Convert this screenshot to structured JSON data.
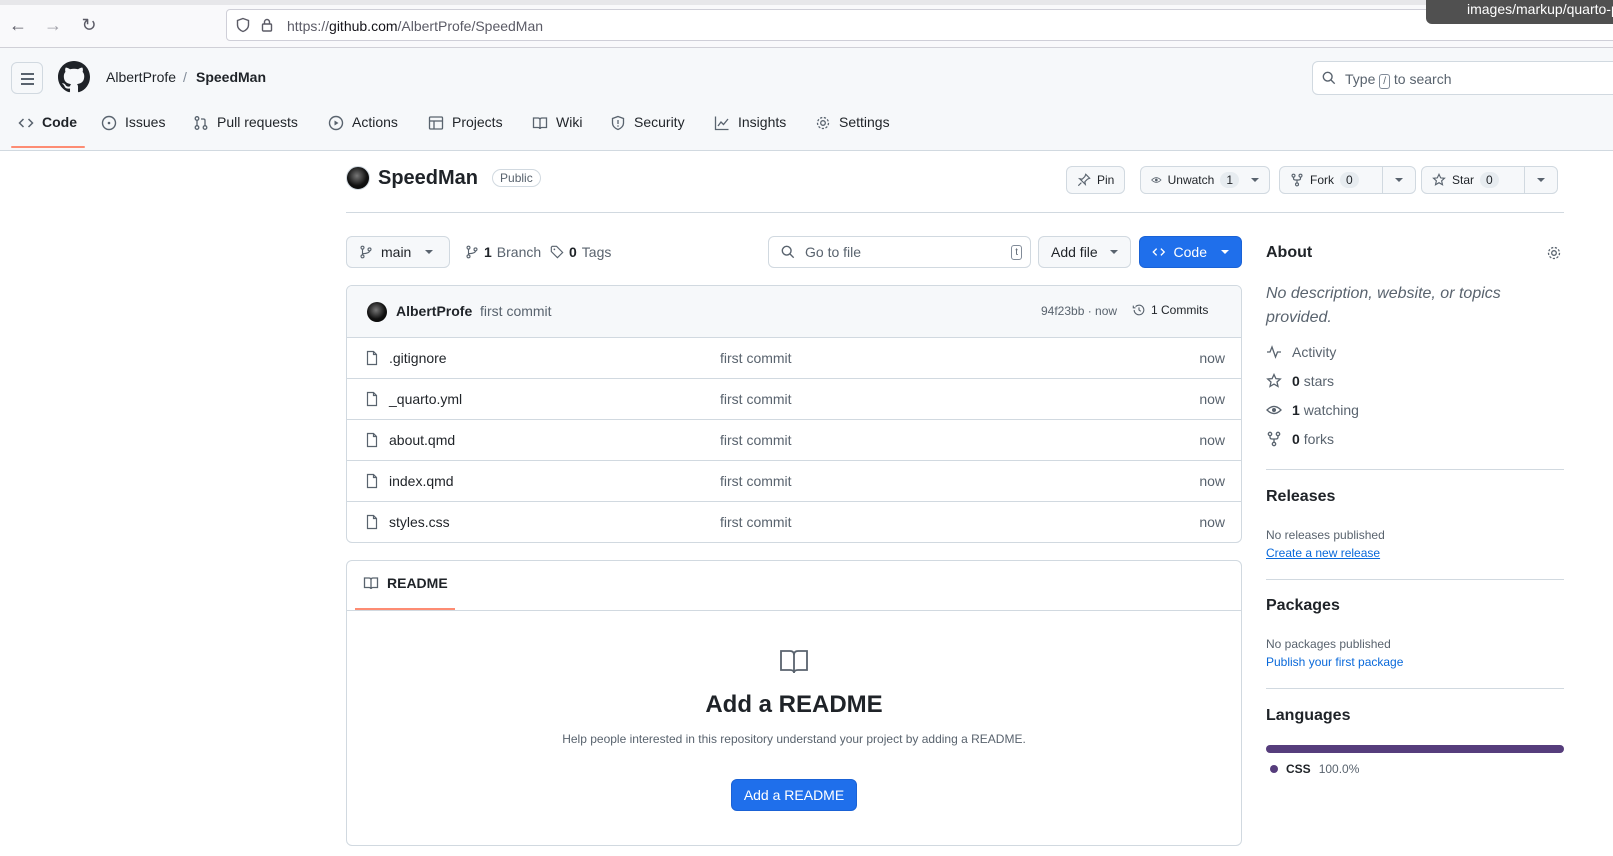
{
  "browser": {
    "url_prefix": "https://",
    "url_domain": "github.com",
    "url_path": "/AlbertProfe/SpeedMan",
    "tooltip": "images/markup/quarto-p"
  },
  "header": {
    "owner": "AlbertProfe",
    "separator": "/",
    "repo": "SpeedMan",
    "search_pre": "Type",
    "search_key": "/",
    "search_post": "to search"
  },
  "tabs": [
    {
      "label": "Code",
      "icon": "code-icon"
    },
    {
      "label": "Issues",
      "icon": "issue-icon"
    },
    {
      "label": "Pull requests",
      "icon": "pull-request-icon"
    },
    {
      "label": "Actions",
      "icon": "play-icon"
    },
    {
      "label": "Projects",
      "icon": "table-icon"
    },
    {
      "label": "Wiki",
      "icon": "book-icon"
    },
    {
      "label": "Security",
      "icon": "shield-icon"
    },
    {
      "label": "Insights",
      "icon": "graph-icon"
    },
    {
      "label": "Settings",
      "icon": "gear-icon"
    }
  ],
  "repo": {
    "name": "SpeedMan",
    "visibility": "Public",
    "pin_label": "Pin",
    "watch_label": "Unwatch",
    "watch_count": "1",
    "fork_label": "Fork",
    "fork_count": "0",
    "star_label": "Star",
    "star_count": "0"
  },
  "filenav": {
    "branch": "main",
    "branch_count": "1",
    "branch_label": "Branch",
    "tag_count": "0",
    "tag_label": "Tags",
    "goto_placeholder": "Go to file",
    "goto_key": "t",
    "add_file": "Add file",
    "code": "Code"
  },
  "commit": {
    "author": "AlbertProfe",
    "message": "first commit",
    "hash_time": "94f23bb · now",
    "commits_label": "1 Commits"
  },
  "files": [
    {
      "name": ".gitignore",
      "message": "first commit",
      "time": "now"
    },
    {
      "name": "_quarto.yml",
      "message": "first commit",
      "time": "now"
    },
    {
      "name": "about.qmd",
      "message": "first commit",
      "time": "now"
    },
    {
      "name": "index.qmd",
      "message": "first commit",
      "time": "now"
    },
    {
      "name": "styles.css",
      "message": "first commit",
      "time": "now"
    }
  ],
  "readme": {
    "tab": "README",
    "title": "Add a README",
    "description": "Help people interested in this repository understand your project by adding a README.",
    "button": "Add a README"
  },
  "about": {
    "heading": "About",
    "description": "No description, website, or topics provided.",
    "activity": "Activity",
    "stars_count": "0",
    "stars_label": "stars",
    "watching_count": "1",
    "watching_label": "watching",
    "forks_count": "0",
    "forks_label": "forks"
  },
  "releases": {
    "heading": "Releases",
    "empty": "No releases published",
    "link": "Create a new release"
  },
  "packages": {
    "heading": "Packages",
    "empty": "No packages published",
    "link": "Publish your first package"
  },
  "languages": {
    "heading": "Languages",
    "items": [
      {
        "name": "CSS",
        "percent": "100.0%",
        "fraction": 1.0,
        "color": "#563d7c"
      }
    ]
  },
  "colors": {
    "primary_button": "#1f6feb",
    "tab_underline": "#fd8c73",
    "link": "#0969da"
  }
}
